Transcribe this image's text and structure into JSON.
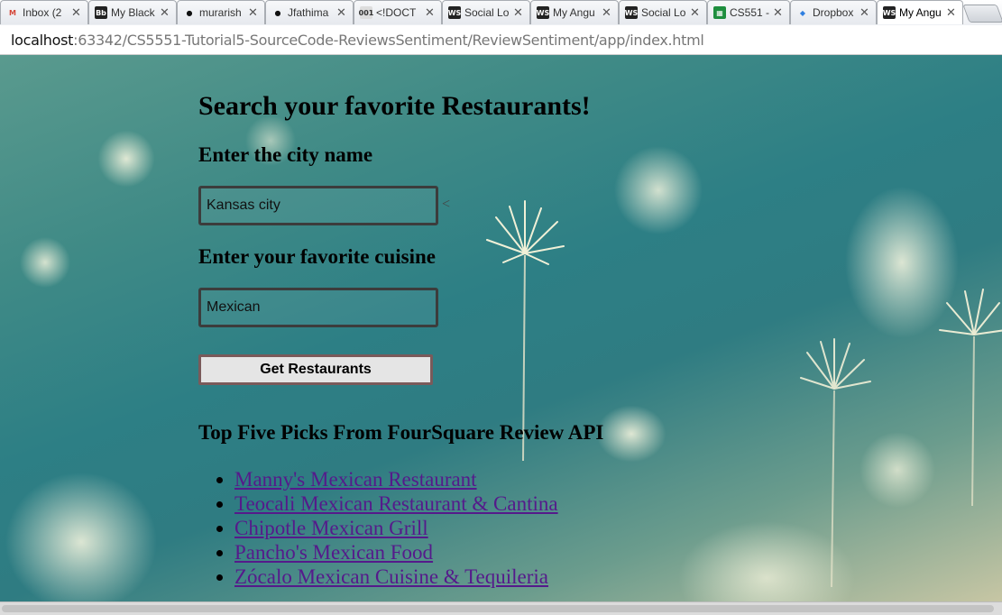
{
  "browser": {
    "tabs": [
      {
        "label": "Inbox (2",
        "icon": "gmail-icon",
        "icon_glyph": "M",
        "icon_color": "#d44638",
        "icon_text_color": "#d44638",
        "icon_bg": "transparent"
      },
      {
        "label": "My Black",
        "icon": "blackboard-icon",
        "icon_glyph": "Bb",
        "icon_color": "#222222",
        "icon_text_color": "#ffffff",
        "icon_bg": "#222222"
      },
      {
        "label": "murarish",
        "icon": "github-icon",
        "icon_glyph": "●",
        "icon_color": "#111111",
        "icon_text_color": "#111111",
        "icon_bg": "transparent"
      },
      {
        "label": "Jfathima",
        "icon": "github-icon",
        "icon_glyph": "●",
        "icon_color": "#111111",
        "icon_text_color": "#111111",
        "icon_bg": "transparent"
      },
      {
        "label": "<!DOCT",
        "icon": "document-icon",
        "icon_glyph": "001",
        "icon_color": "#555555",
        "icon_text_color": "#333333",
        "icon_bg": "#dddddd"
      },
      {
        "label": "Social Lo",
        "icon": "webstorm-icon",
        "icon_glyph": "WS",
        "icon_color": "#222222",
        "icon_text_color": "#ffffff",
        "icon_bg": "#222222"
      },
      {
        "label": "My Angu",
        "icon": "webstorm-icon",
        "icon_glyph": "WS",
        "icon_color": "#222222",
        "icon_text_color": "#ffffff",
        "icon_bg": "#222222"
      },
      {
        "label": "Social Lo",
        "icon": "webstorm-icon",
        "icon_glyph": "WS",
        "icon_color": "#222222",
        "icon_text_color": "#ffffff",
        "icon_bg": "#222222"
      },
      {
        "label": "CS551 -",
        "icon": "sheets-icon",
        "icon_glyph": "▦",
        "icon_color": "#1e8e3e",
        "icon_text_color": "#ffffff",
        "icon_bg": "#1e8e3e"
      },
      {
        "label": "Dropbox",
        "icon": "dropbox-icon",
        "icon_glyph": "◆",
        "icon_color": "#2f7fe0",
        "icon_text_color": "#2f7fe0",
        "icon_bg": "transparent"
      },
      {
        "label": "My Angu",
        "icon": "webstorm-icon",
        "icon_glyph": "WS",
        "icon_color": "#222222",
        "icon_text_color": "#ffffff",
        "icon_bg": "#222222",
        "active": true
      }
    ],
    "close_glyph": "✕",
    "url_host": "localhost",
    "url_rest": ":63342/CS5551-Tutorial5-SourceCode-ReviewsSentiment/ReviewSentiment/app/index.html"
  },
  "page": {
    "title": "Search your favorite Restaurants!",
    "city_label": "Enter the city name",
    "city_value": "Kansas city",
    "stray_text": "<",
    "cuisine_label": "Enter your favorite cuisine",
    "cuisine_value": "Mexican",
    "button_label": "Get Restaurants",
    "results_heading": "Top Five Picks From FourSquare Review API",
    "results": [
      "Manny's Mexican Restaurant",
      "Teocali Mexican Restaurant & Cantina",
      "Chipotle Mexican Grill",
      "Pancho's Mexican Food",
      "Zócalo Mexican Cuisine & Tequileria"
    ]
  }
}
